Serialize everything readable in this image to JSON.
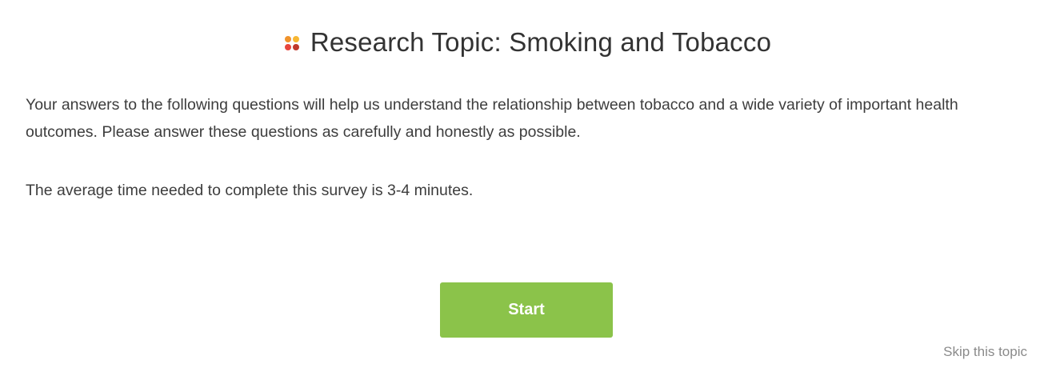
{
  "header": {
    "title": "Research Topic: Smoking and Tobacco",
    "logo_icon": "four-dots-logo-icon",
    "logo_colors": [
      "#f0932b",
      "#f7b733",
      "#e8453c",
      "#c0392b"
    ]
  },
  "intro": {
    "description": "Your answers to the following questions will help us understand the relationship between tobacco and a wide variety of important health outcomes. Please answer these questions as carefully and honestly as possible.",
    "time_note": "The average time needed to complete this survey is 3-4 minutes."
  },
  "actions": {
    "start_label": "Start",
    "start_color": "#8bc34a",
    "skip_label": "Skip this topic"
  }
}
